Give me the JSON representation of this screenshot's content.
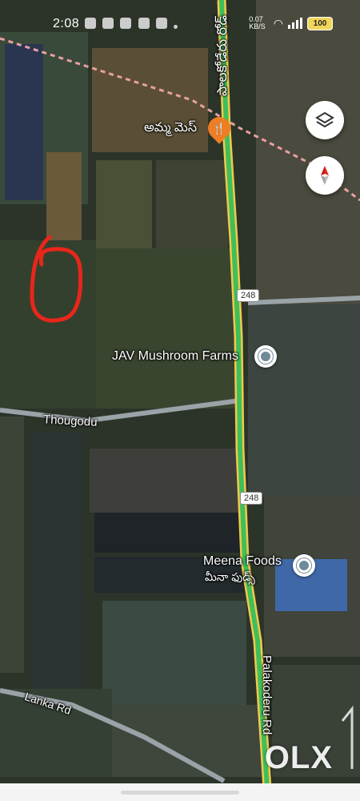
{
  "status_bar": {
    "time": "2:08",
    "network_rate": "0.07\nKB/S",
    "battery": "100"
  },
  "map": {
    "places": [
      {
        "name": "అమ్మ మెస్",
        "icon": "restaurant-icon"
      },
      {
        "name": "JAV Mushroom Farms",
        "icon": "place-pin-icon"
      },
      {
        "name": "Meena Foods",
        "name_local": "మీనా ఫుడ్స్",
        "icon": "place-pin-icon"
      }
    ],
    "roads": [
      {
        "name": "Thougodu"
      },
      {
        "name": "Lanka Rd"
      },
      {
        "name": "Palakoderu Rd"
      },
      {
        "name": "పాలకోడేరు రోడ్"
      }
    ],
    "route_shields": [
      "248",
      "248"
    ]
  },
  "controls": {
    "layers_icon": "layers-icon",
    "compass_icon": "compass-icon"
  },
  "watermark": "OLX",
  "colors": {
    "main_road": "#3fbf5a",
    "road_casing": "#f2c94c",
    "side_road": "#9aa3a8",
    "marker_circle": "#e8261a",
    "railway_dash": "#e8a0a0"
  }
}
